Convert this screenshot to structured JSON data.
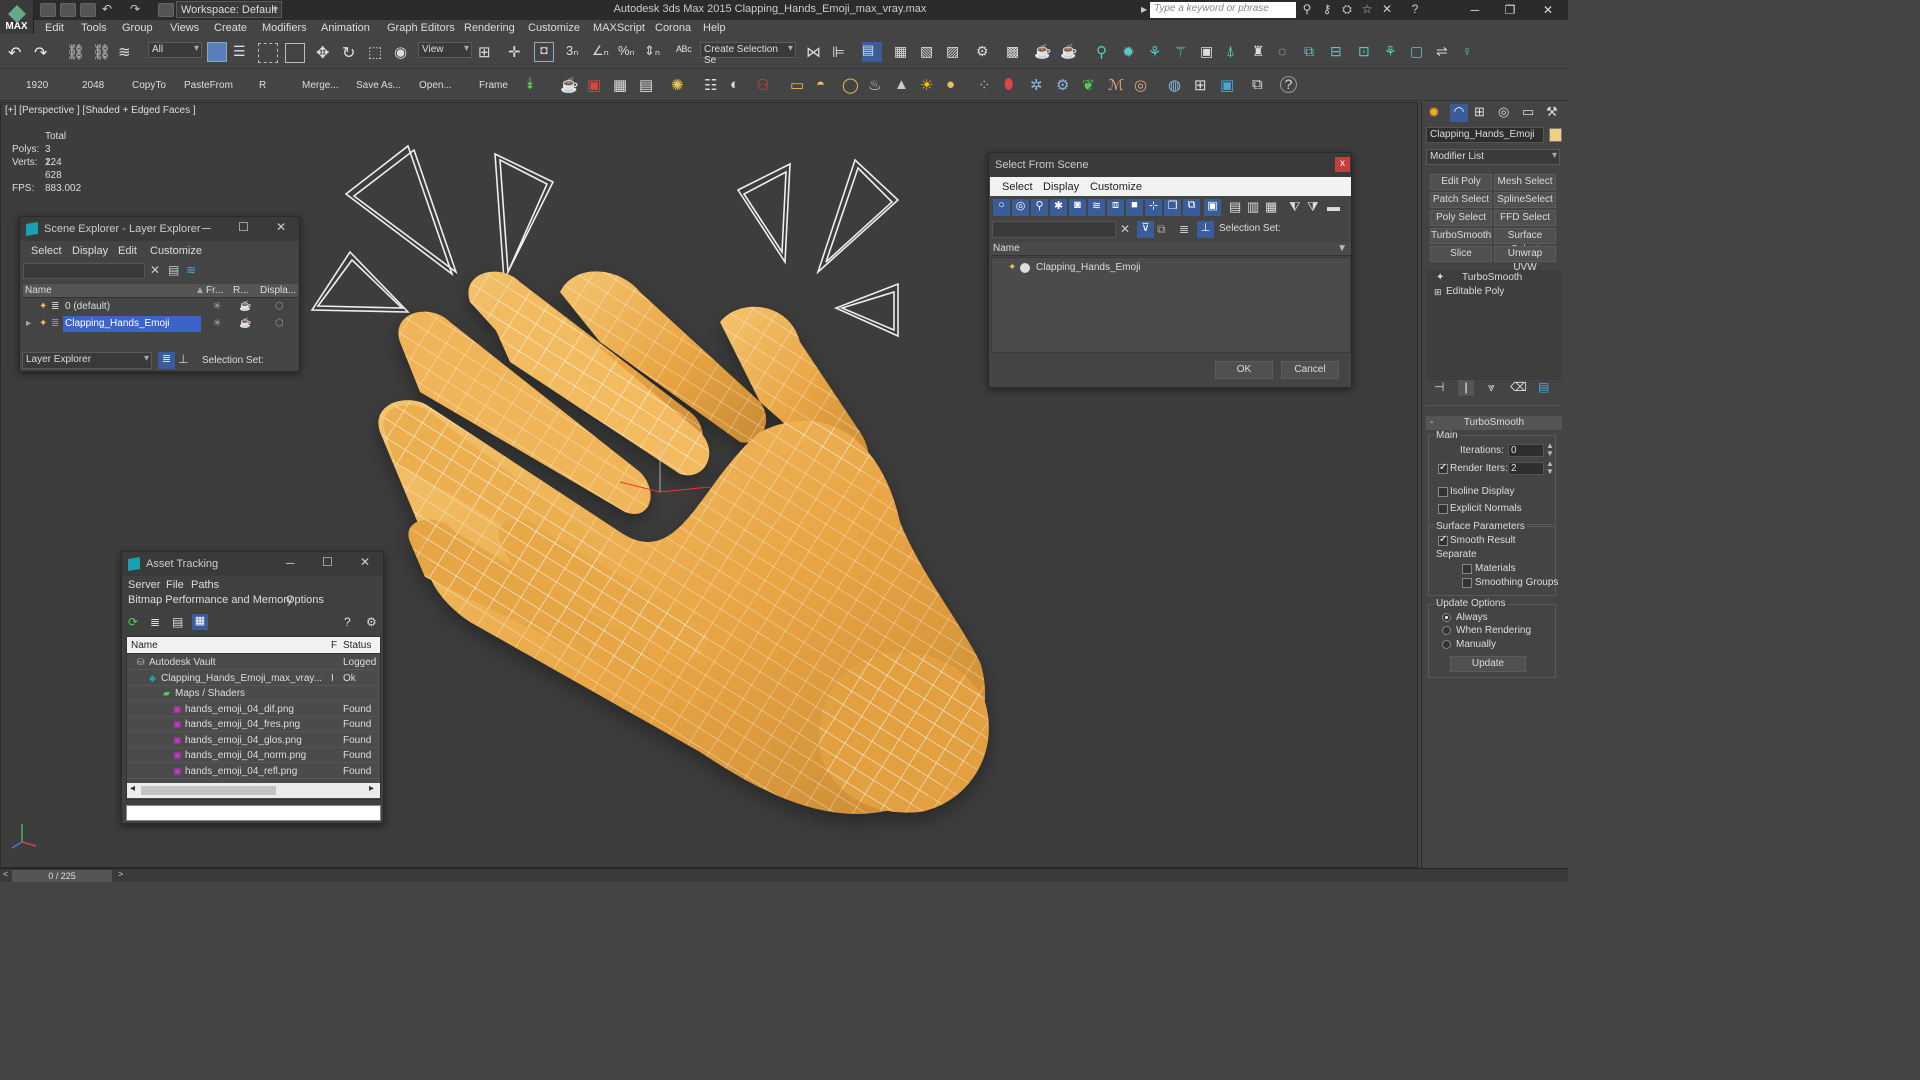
{
  "app": {
    "window_title": "Autodesk 3ds Max  2015     Clapping_Hands_Emoji_max_vray.max",
    "logo_text": "MAX",
    "workspace_label": "Workspace: Default",
    "search_placeholder": "Type a keyword or phrase"
  },
  "menu": [
    "Edit",
    "Tools",
    "Group",
    "Views",
    "Create",
    "Modifiers",
    "Animation",
    "Graph Editors",
    "Rendering",
    "Customize",
    "MAXScript",
    "Corona",
    "Help"
  ],
  "toolbar1": {
    "selection_filter": "All",
    "ref_coord": "View",
    "selection_set_placeholder": "Create Selection Se"
  },
  "toolbar2": {
    "labels": [
      "1920",
      "2048",
      "CopyTo",
      "PasteFrom",
      "R",
      "Merge...",
      "Save As...",
      "Open...",
      "Frame"
    ]
  },
  "viewport": {
    "label": "[+] [Perspective ] [Shaded + Edged Faces ]",
    "stats_header": "Total",
    "polys_label": "Polys:",
    "polys_value": "3 224",
    "verts_label": "Verts:",
    "verts_value": "1 628",
    "fps_label": "FPS:",
    "fps_value": "883.002"
  },
  "scene_explorer": {
    "title": "Scene Explorer - Layer Explorer",
    "menu": [
      "Select",
      "Display",
      "Edit",
      "Customize"
    ],
    "columns": [
      "Name",
      "Fr...",
      "R...",
      "Displa..."
    ],
    "rows": [
      "0 (default)",
      "Clapping_Hands_Emoji"
    ],
    "footer_dropdown": "Layer Explorer",
    "selection_set_label": "Selection Set:"
  },
  "select_from_scene": {
    "title": "Select From Scene",
    "menu": [
      "Select",
      "Display",
      "Customize"
    ],
    "selection_set_label": "Selection Set:",
    "column": "Name",
    "item": "Clapping_Hands_Emoji",
    "ok": "OK",
    "cancel": "Cancel",
    "close": "x"
  },
  "asset_tracking": {
    "title": "Asset Tracking",
    "menu": [
      "Server",
      "File",
      "Paths"
    ],
    "menu2": [
      "Bitmap Performance and Memory",
      "Options"
    ],
    "col_name": "Name",
    "col_f": "F",
    "col_status": "Status",
    "rows": [
      {
        "name": "Autodesk Vault",
        "f": "",
        "status": "Logged"
      },
      {
        "name": "Clapping_Hands_Emoji_max_vray...",
        "f": "I",
        "status": "Ok"
      },
      {
        "name": "Maps / Shaders",
        "f": "",
        "status": ""
      },
      {
        "name": "hands_emoji_04_dif.png",
        "f": "",
        "status": "Found"
      },
      {
        "name": "hands_emoji_04_fres.png",
        "f": "",
        "status": "Found"
      },
      {
        "name": "hands_emoji_04_glos.png",
        "f": "",
        "status": "Found"
      },
      {
        "name": "hands_emoji_04_norm.png",
        "f": "",
        "status": "Found"
      },
      {
        "name": "hands_emoji_04_refl.png",
        "f": "",
        "status": "Found"
      }
    ]
  },
  "command_panel": {
    "object_name": "Clapping_Hands_Emoji",
    "modifier_list": "Modifier List",
    "buttons": [
      "Edit Poly",
      "Mesh Select",
      "Patch Select",
      "SplineSelect",
      "Poly Select",
      "FFD Select",
      "TurboSmooth",
      "Surface Select",
      "Slice",
      "Unwrap UVW"
    ],
    "stack": [
      "TurboSmooth",
      "Editable Poly"
    ],
    "rollout_title": "TurboSmooth",
    "main_label": "Main",
    "iterations_label": "Iterations:",
    "iterations_value": "0",
    "render_iters_label": "Render Iters:",
    "render_iters_value": "2",
    "isoline_label": "Isoline Display",
    "explicit_normals_label": "Explicit Normals",
    "surface_params_label": "Surface Parameters",
    "smooth_result_label": "Smooth Result",
    "separate_label": "Separate",
    "materials_label": "Materials",
    "smoothing_groups_label": "Smoothing Groups",
    "update_options_label": "Update Options",
    "always_label": "Always",
    "when_rendering_label": "When Rendering",
    "manually_label": "Manually",
    "update_button": "Update",
    "render_iters_checked": true,
    "smooth_result_checked": true
  },
  "status": {
    "time_slider": "0 / 225"
  },
  "colors": {
    "hand_base": "#e9a544",
    "hand_light": "#f2c06a",
    "hand_dark": "#b9782a",
    "selection_blue": "#3c63c8",
    "stat_yellow": "#e8c25a"
  }
}
